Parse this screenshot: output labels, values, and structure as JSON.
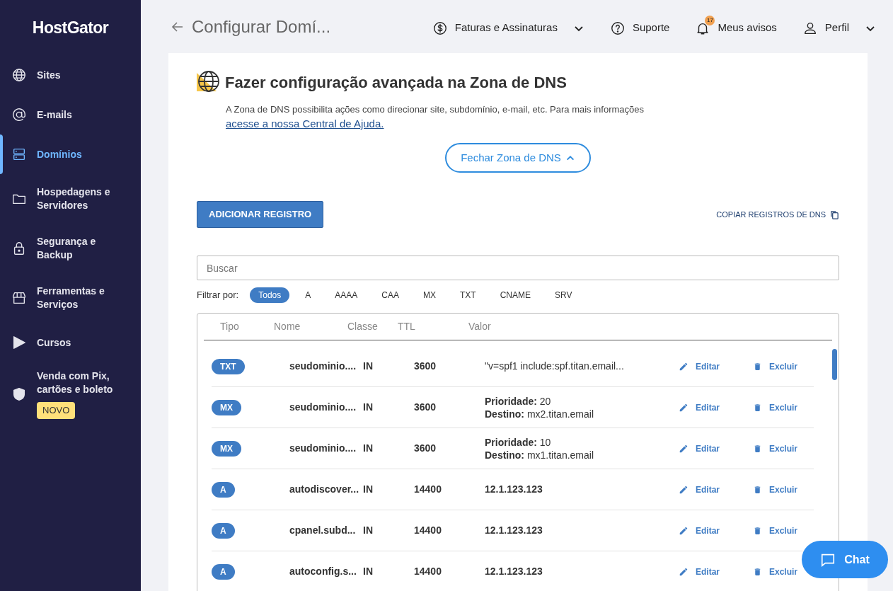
{
  "sidebar": {
    "logo": "HostGator",
    "items": [
      {
        "label": "Sites",
        "selected": false
      },
      {
        "label": "E-mails",
        "selected": false
      },
      {
        "label": "Domínios",
        "selected": true
      },
      {
        "label": "Hospedagens e Servidores",
        "selected": false
      },
      {
        "label": "Segurança e Backup",
        "selected": false
      },
      {
        "label": "Ferramentas e Serviços",
        "selected": false
      },
      {
        "label": "Cursos",
        "selected": false
      },
      {
        "label": "Venda com Pix, cartões e boleto",
        "selected": false,
        "badge": "NOVO"
      }
    ]
  },
  "topbar": {
    "title": "Configurar Domí...",
    "menus": [
      {
        "label": "Faturas e Assinaturas",
        "dropdown": true
      },
      {
        "label": "Suporte",
        "dropdown": false
      },
      {
        "label": "Meus avisos",
        "dropdown": false,
        "count": "17"
      },
      {
        "label": "Perfil",
        "dropdown": true
      }
    ]
  },
  "section": {
    "title": "Fazer configuração avançada na Zona de DNS",
    "description": "A Zona de DNS possibilita ações como direcionar site, subdomínio, e-mail, etc. Para mais informações",
    "link": "acesse a nossa Central de Ajuda.",
    "toggle": "Fechar Zona de DNS",
    "add_button": "ADICIONAR REGISTRO",
    "copy_link": "COPIAR REGISTROS DE DNS",
    "search": {
      "placeholder": "Buscar"
    },
    "filter_label": "Filtrar por:",
    "filters": [
      {
        "label": "Todos",
        "selected": true
      },
      {
        "label": "A",
        "selected": false
      },
      {
        "label": "AAAA",
        "selected": false
      },
      {
        "label": "CAA",
        "selected": false
      },
      {
        "label": "MX",
        "selected": false
      },
      {
        "label": "TXT",
        "selected": false
      },
      {
        "label": "CNAME",
        "selected": false
      },
      {
        "label": "SRV",
        "selected": false
      }
    ]
  },
  "table": {
    "columns": [
      "Tipo",
      "Nome",
      "Classe",
      "TTL",
      "Valor"
    ],
    "rows": [
      {
        "type": "TXT",
        "name": "seudominio....",
        "class": "IN",
        "ttl": "3600",
        "value": "\"v=spf1 include:spf.titan.email...",
        "edit": "Editar",
        "delete": "Excluir"
      },
      {
        "type": "MX",
        "name": "seudominio....",
        "class": "IN",
        "ttl": "3600",
        "value_lines": [
          "**Prioridade:** 20",
          "**Destino:** mx2.titan.email"
        ],
        "edit": "Editar",
        "delete": "Excluir"
      },
      {
        "type": "MX",
        "name": "seudominio....",
        "class": "IN",
        "ttl": "3600",
        "value_lines": [
          "**Prioridade:** 10",
          "**Destino:** mx1.titan.email"
        ],
        "edit": "Editar",
        "delete": "Excluir"
      },
      {
        "type": "A",
        "name": "autodiscover...",
        "class": "IN",
        "ttl": "14400",
        "value": "12.1.123.123",
        "edit": "Editar",
        "delete": "Excluir"
      },
      {
        "type": "A",
        "name": "cpanel.subd...",
        "class": "IN",
        "ttl": "14400",
        "value": "12.1.123.123",
        "edit": "Editar",
        "delete": "Excluir"
      },
      {
        "type": "A",
        "name": "autoconfig.s...",
        "class": "IN",
        "ttl": "14400",
        "value": "12.1.123.123",
        "edit": "Editar",
        "delete": "Excluir"
      }
    ]
  },
  "chat": {
    "label": "Chat"
  }
}
